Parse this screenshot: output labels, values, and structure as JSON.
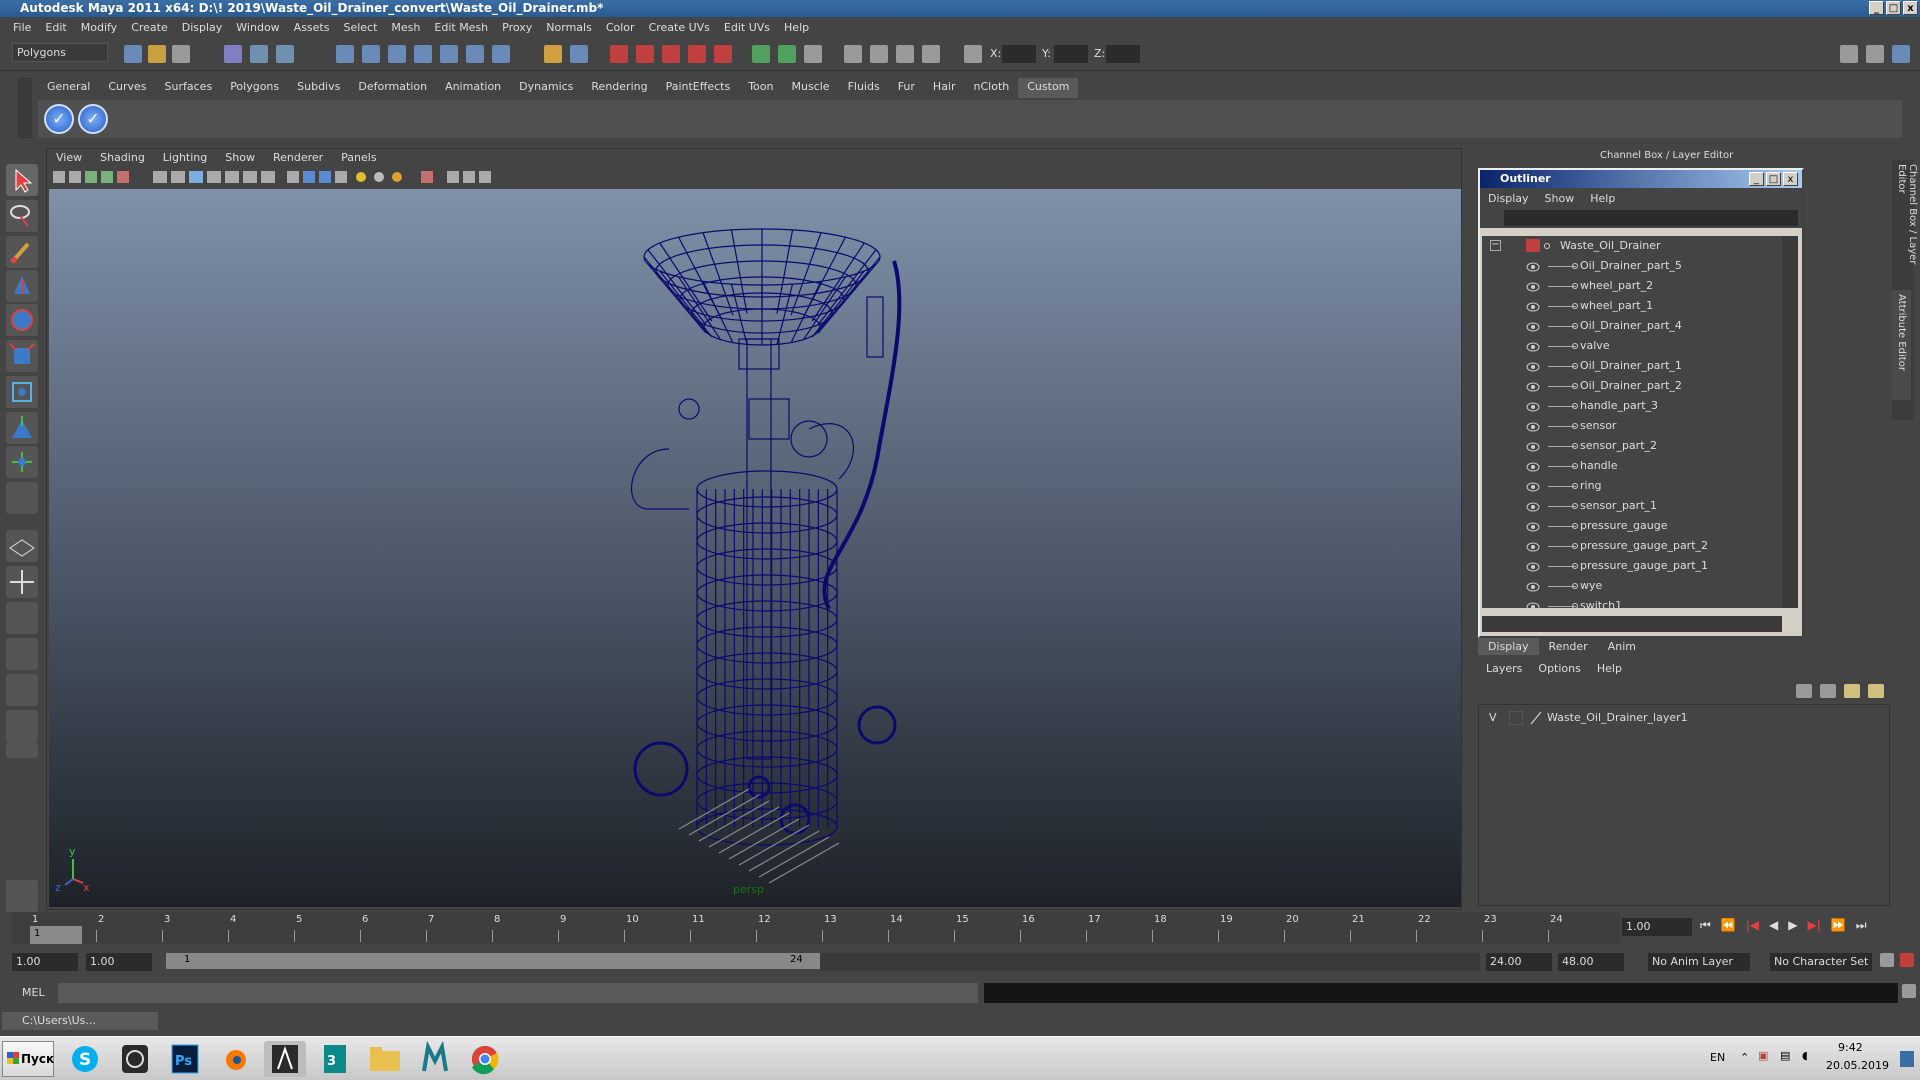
{
  "window": {
    "title": "Autodesk Maya 2011 x64: D:\\! 2019\\Waste_Oil_Drainer_convert\\Waste_Oil_Drainer.mb*",
    "controls": [
      "_",
      "□",
      "x"
    ]
  },
  "menubar": [
    "File",
    "Edit",
    "Modify",
    "Create",
    "Display",
    "Window",
    "Assets",
    "Select",
    "Mesh",
    "Edit Mesh",
    "Proxy",
    "Normals",
    "Color",
    "Create UVs",
    "Edit UVs",
    "Help"
  ],
  "statusline": {
    "mode": "Polygons",
    "x_label": "X:",
    "y_label": "Y:",
    "z_label": "Z:"
  },
  "shelf": {
    "tabs": [
      "General",
      "Curves",
      "Surfaces",
      "Polygons",
      "Subdivs",
      "Deformation",
      "Animation",
      "Dynamics",
      "Rendering",
      "PaintEffects",
      "Toon",
      "Muscle",
      "Fluids",
      "Fur",
      "Hair",
      "nCloth",
      "Custom"
    ],
    "active_tab": "Custom",
    "buttons": [
      "check-icon",
      "check-icon"
    ]
  },
  "viewport": {
    "menu": [
      "View",
      "Shading",
      "Lighting",
      "Show",
      "Renderer",
      "Panels"
    ],
    "camera": "persp",
    "axis_y": "y",
    "axis_z": "z",
    "axis_x": "x",
    "wire_color": "#0a0a6e"
  },
  "channel_box": {
    "title": "Channel Box / Layer Editor",
    "side_tabs": [
      "Channel Box / Layer Editor",
      "Attribute Editor"
    ]
  },
  "outliner": {
    "title": "Outliner",
    "menu": [
      "Display",
      "Show",
      "Help"
    ],
    "root": "Waste_Oil_Drainer",
    "items": [
      "Oil_Drainer_part_5",
      "wheel_part_2",
      "wheel_part_1",
      "Oil_Drainer_part_4",
      "valve",
      "Oil_Drainer_part_1",
      "Oil_Drainer_part_2",
      "handle_part_3",
      "sensor",
      "sensor_part_2",
      "handle",
      "ring",
      "sensor_part_1",
      "pressure_gauge",
      "pressure_gauge_part_2",
      "pressure_gauge_part_1",
      "wye",
      "switch1"
    ]
  },
  "layer_editor": {
    "tabs": [
      "Display",
      "Render",
      "Anim"
    ],
    "active_tab": "Display",
    "menu": [
      "Layers",
      "Options",
      "Help"
    ],
    "layer": {
      "visible": "V",
      "name": "Waste_Oil_Drainer_layer1"
    }
  },
  "timeline": {
    "ticks": [
      "1",
      "2",
      "3",
      "4",
      "5",
      "6",
      "7",
      "8",
      "9",
      "10",
      "11",
      "12",
      "13",
      "14",
      "15",
      "16",
      "17",
      "18",
      "19",
      "20",
      "21",
      "22",
      "23",
      "24"
    ],
    "current_frame": "1",
    "current_time": "1.00"
  },
  "range": {
    "start": "1.00",
    "playback_start": "1.00",
    "slider_start": "1",
    "slider_end": "24",
    "playback_end": "24.00",
    "end": "48.00",
    "anim_layer": "No Anim Layer",
    "character_set": "No Character Set"
  },
  "command_line": {
    "label": "MEL"
  },
  "mini_window": {
    "title": "C:\\Users\\Us..."
  },
  "taskbar": {
    "start": "Пуск",
    "apps": [
      "skype-icon",
      "sketchup-icon",
      "photoshop-icon",
      "blender-icon",
      "inkscape-icon",
      "3dsmax-icon",
      "explorer-icon",
      "maya-icon",
      "chrome-icon"
    ],
    "lang": "EN",
    "time": "9:42",
    "date": "20.05.2019"
  }
}
